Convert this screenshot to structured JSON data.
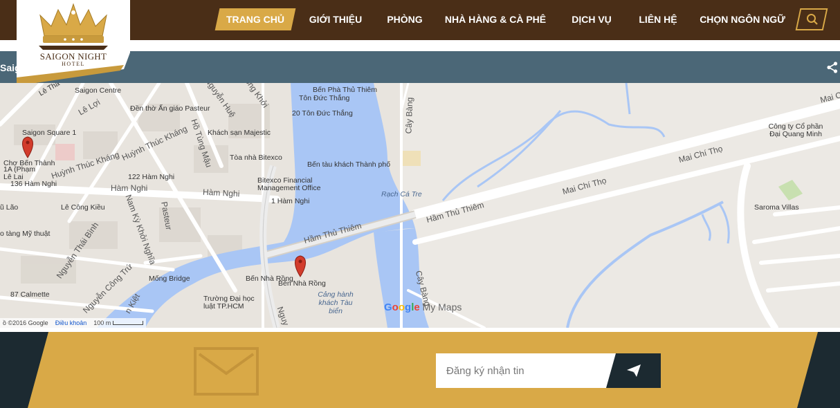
{
  "logo": {
    "name": "SAIGON NIGHT",
    "sub": "HOTEL"
  },
  "nav": {
    "items": [
      {
        "label": "TRANG CHỦ",
        "active": true
      },
      {
        "label": "GIỚI THIỆU",
        "active": false
      },
      {
        "label": "PHÒNG",
        "active": false
      },
      {
        "label": "NHÀ HÀNG & CÀ PHÊ",
        "active": false
      },
      {
        "label": "DỊCH VỤ",
        "active": false
      },
      {
        "label": "LIÊN HỆ",
        "active": false
      },
      {
        "label": "CHỌN NGÔN NGỮ",
        "active": false
      }
    ],
    "search_icon": "search-icon"
  },
  "map": {
    "title": "Saigo",
    "labels": {
      "le_thanh": "Lê Thá",
      "saigon_centre": "Saigon Centre",
      "le_loi": "Lê Lợi",
      "den_tho": "Đền thờ Ấn giáo Pasteur",
      "nguyen_hue": "Nguyễn Huệ",
      "dong_khoi": "Đồng Khởi",
      "ben_pha": "Bến Phà Thủ Thiêm",
      "ton_duc_thang": "Tôn Đức Thắng",
      "tdt20": "20 Tôn Đức Thắng",
      "cay_bang": "Cây Bàng",
      "saigon_square": "Saigon Square 1",
      "ks_majestic": "Khách sạn Majestic",
      "huynh_thuc_khang": "Huỳnh Thúc Kháng",
      "ho_tung_mau": "Hồ Tùng Mậu",
      "cho_ben_thanh": "Chợ Bến Thành",
      "toa_nha_bitexco": "Tòa nhà Bitexco",
      "ben_tau": "Bến tàu khách Thành phố",
      "le_lai": "1A (Phạm Lê Lai",
      "huynh_thuc_khang2": "Huỳnh Thúc Kháng",
      "ham_nghi_122": "122 Hàm Nghi",
      "ham_nghi_136": "136 Hàm Nghi",
      "ham_nghi": "Hàm Nghi",
      "ham_nghi2": "Hàm Nghi",
      "bitexco_fmo": "Bitexco Financial Management Office",
      "ham_nghi_1": "1 Hàm Nghi",
      "rach_ca_tre": "Rạch Cá Tre",
      "mai_chi_tho": "Mai Chí Thọ",
      "mai_chi_tho2": "Mai Chí Thọ",
      "cong_ty": "Công ty Cổ phần Đại Quang Minh",
      "mai_c": "Mai C",
      "u_lao": "ũ Lão",
      "le_cong_kieu": "Lê Công Kiều",
      "ham_thu_thiem": "Hầm Thủ Thiêm",
      "ham_thu_thiem2": "Hầm Thủ Thiêm",
      "saroma": "Saroma Villas",
      "bao_tang": "o tàng Mỹ thuật",
      "nguyen_thai_binh": "Nguyễn Thái Bình",
      "nam_ky": "Nam Kỳ Khởi Nghĩa",
      "pasteur": "Pasteur",
      "mong_bridge": "Mống Bridge",
      "ben_nha_rong": "Bến Nhà Rồng",
      "ben_nha_rong2": "Bến Nhà Rồng",
      "nguyen_cong_tru": "Nguyễn Công Trứ",
      "calmette": "87 Calmette",
      "truong_dai_hoc": "Trường Đại học luật TP.HCM",
      "cang_hanh_khach": "Cảng hành khách Tàu biển",
      "cay_bang2": "Cây Bàng",
      "kiet": "n Kiệt",
      "nguy": "Nguy"
    },
    "google": {
      "g": "G",
      "o1": "o",
      "o2": "o",
      "g2": "g",
      "l": "l",
      "e": "e",
      "mymaps": " My Maps"
    },
    "attribution": {
      "copyright": "ồ ©2016 Google",
      "terms": "Điều khoản",
      "scale": "100 m"
    }
  },
  "footer": {
    "envelope_icon": "envelope-icon",
    "placeholder": "Đăng ký nhận tin",
    "send_icon": "send-icon"
  },
  "colors": {
    "nav_bg": "#4a2e17",
    "accent": "#d9a947",
    "map_header": "#4b6777",
    "footer_dark": "#1c2a31",
    "water": "#a9c6f5"
  }
}
